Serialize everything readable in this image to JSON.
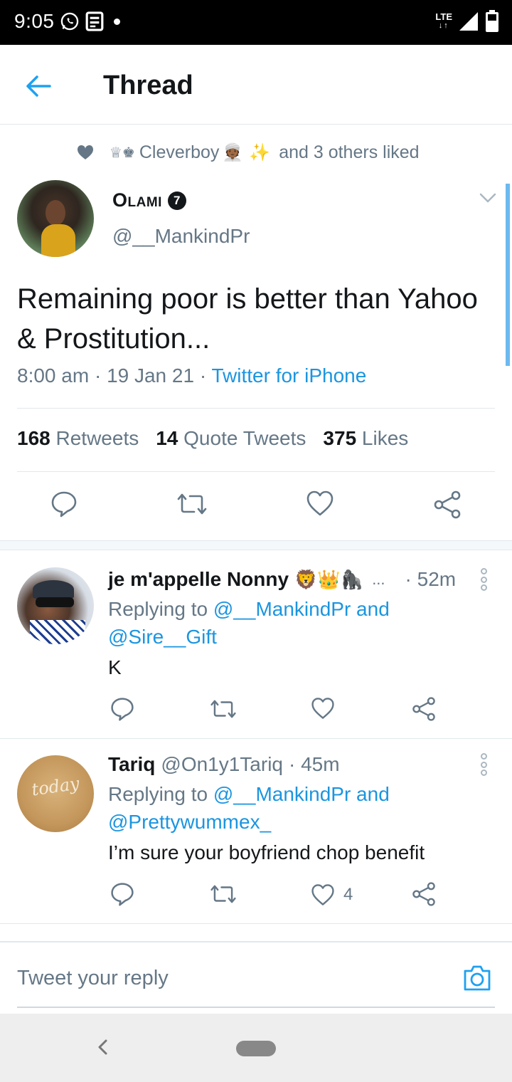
{
  "status_bar": {
    "time": "9:05",
    "network": "LTE"
  },
  "header": {
    "title": "Thread"
  },
  "liked_by": {
    "prefix": "♕♚",
    "name": "Cleverboy",
    "emoji1": "👳🏾",
    "emoji2": "✨",
    "suffix": "and 3 others liked"
  },
  "tweet": {
    "author_name": "Olami",
    "badge": "7",
    "handle": "@__MankindPr",
    "text": "Remaining poor is better than Yahoo & Prostitution...",
    "time": "8:00 am",
    "date": "19 Jan 21",
    "source": "Twitter for iPhone",
    "retweets_count": "168",
    "retweets_label": "Retweets",
    "quotes_count": "14",
    "quotes_label": "Quote Tweets",
    "likes_count": "375",
    "likes_label": "Likes"
  },
  "replies": [
    {
      "name": "je m'appelle Nonny",
      "emojis": "🦁👑🦍",
      "ellipsis": "...",
      "time": "· 52m",
      "replying_prefix": "Replying to",
      "replying_to_1": "@__MankindPr and",
      "replying_to_2": "@Sire__Gift",
      "text": "K",
      "like_count": ""
    },
    {
      "name": "Tariq",
      "handle": "@On1y1Tariq",
      "time": "· 45m",
      "replying_prefix": "Replying to",
      "replying_to_1": "@__MankindPr and",
      "replying_to_2": "@Prettywummex_",
      "text": "I’m sure your boyfriend chop benefit",
      "like_count": "4",
      "avatar_logo": "today"
    }
  ],
  "composer": {
    "placeholder": "Tweet your reply"
  },
  "colors": {
    "accent": "#1b95e0",
    "muted": "#657786",
    "text": "#14171a"
  }
}
